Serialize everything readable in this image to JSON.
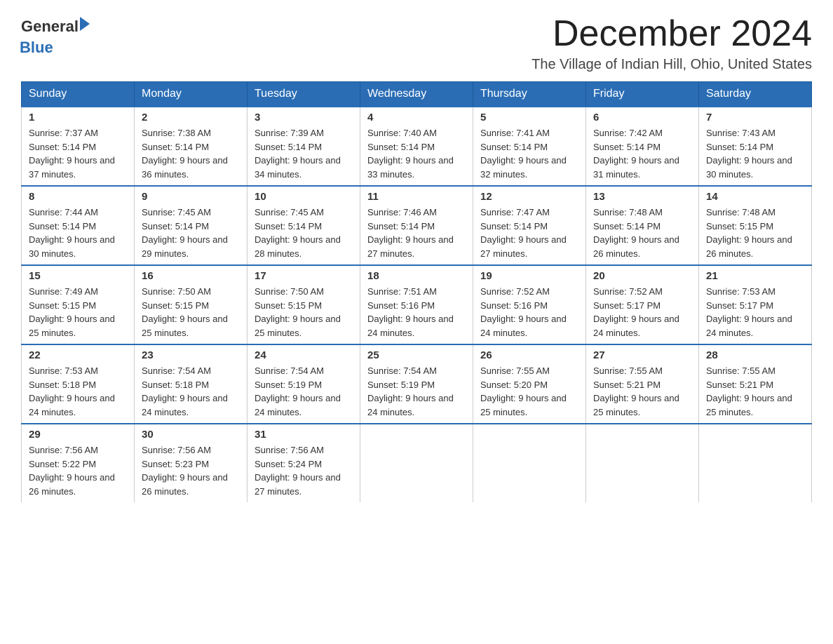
{
  "header": {
    "logo_general": "General",
    "logo_blue": "Blue",
    "month_title": "December 2024",
    "location": "The Village of Indian Hill, Ohio, United States"
  },
  "days_of_week": [
    "Sunday",
    "Monday",
    "Tuesday",
    "Wednesday",
    "Thursday",
    "Friday",
    "Saturday"
  ],
  "weeks": [
    [
      {
        "day": "1",
        "sunrise": "7:37 AM",
        "sunset": "5:14 PM",
        "daylight": "9 hours and 37 minutes."
      },
      {
        "day": "2",
        "sunrise": "7:38 AM",
        "sunset": "5:14 PM",
        "daylight": "9 hours and 36 minutes."
      },
      {
        "day": "3",
        "sunrise": "7:39 AM",
        "sunset": "5:14 PM",
        "daylight": "9 hours and 34 minutes."
      },
      {
        "day": "4",
        "sunrise": "7:40 AM",
        "sunset": "5:14 PM",
        "daylight": "9 hours and 33 minutes."
      },
      {
        "day": "5",
        "sunrise": "7:41 AM",
        "sunset": "5:14 PM",
        "daylight": "9 hours and 32 minutes."
      },
      {
        "day": "6",
        "sunrise": "7:42 AM",
        "sunset": "5:14 PM",
        "daylight": "9 hours and 31 minutes."
      },
      {
        "day": "7",
        "sunrise": "7:43 AM",
        "sunset": "5:14 PM",
        "daylight": "9 hours and 30 minutes."
      }
    ],
    [
      {
        "day": "8",
        "sunrise": "7:44 AM",
        "sunset": "5:14 PM",
        "daylight": "9 hours and 30 minutes."
      },
      {
        "day": "9",
        "sunrise": "7:45 AM",
        "sunset": "5:14 PM",
        "daylight": "9 hours and 29 minutes."
      },
      {
        "day": "10",
        "sunrise": "7:45 AM",
        "sunset": "5:14 PM",
        "daylight": "9 hours and 28 minutes."
      },
      {
        "day": "11",
        "sunrise": "7:46 AM",
        "sunset": "5:14 PM",
        "daylight": "9 hours and 27 minutes."
      },
      {
        "day": "12",
        "sunrise": "7:47 AM",
        "sunset": "5:14 PM",
        "daylight": "9 hours and 27 minutes."
      },
      {
        "day": "13",
        "sunrise": "7:48 AM",
        "sunset": "5:14 PM",
        "daylight": "9 hours and 26 minutes."
      },
      {
        "day": "14",
        "sunrise": "7:48 AM",
        "sunset": "5:15 PM",
        "daylight": "9 hours and 26 minutes."
      }
    ],
    [
      {
        "day": "15",
        "sunrise": "7:49 AM",
        "sunset": "5:15 PM",
        "daylight": "9 hours and 25 minutes."
      },
      {
        "day": "16",
        "sunrise": "7:50 AM",
        "sunset": "5:15 PM",
        "daylight": "9 hours and 25 minutes."
      },
      {
        "day": "17",
        "sunrise": "7:50 AM",
        "sunset": "5:15 PM",
        "daylight": "9 hours and 25 minutes."
      },
      {
        "day": "18",
        "sunrise": "7:51 AM",
        "sunset": "5:16 PM",
        "daylight": "9 hours and 24 minutes."
      },
      {
        "day": "19",
        "sunrise": "7:52 AM",
        "sunset": "5:16 PM",
        "daylight": "9 hours and 24 minutes."
      },
      {
        "day": "20",
        "sunrise": "7:52 AM",
        "sunset": "5:17 PM",
        "daylight": "9 hours and 24 minutes."
      },
      {
        "day": "21",
        "sunrise": "7:53 AM",
        "sunset": "5:17 PM",
        "daylight": "9 hours and 24 minutes."
      }
    ],
    [
      {
        "day": "22",
        "sunrise": "7:53 AM",
        "sunset": "5:18 PM",
        "daylight": "9 hours and 24 minutes."
      },
      {
        "day": "23",
        "sunrise": "7:54 AM",
        "sunset": "5:18 PM",
        "daylight": "9 hours and 24 minutes."
      },
      {
        "day": "24",
        "sunrise": "7:54 AM",
        "sunset": "5:19 PM",
        "daylight": "9 hours and 24 minutes."
      },
      {
        "day": "25",
        "sunrise": "7:54 AM",
        "sunset": "5:19 PM",
        "daylight": "9 hours and 24 minutes."
      },
      {
        "day": "26",
        "sunrise": "7:55 AM",
        "sunset": "5:20 PM",
        "daylight": "9 hours and 25 minutes."
      },
      {
        "day": "27",
        "sunrise": "7:55 AM",
        "sunset": "5:21 PM",
        "daylight": "9 hours and 25 minutes."
      },
      {
        "day": "28",
        "sunrise": "7:55 AM",
        "sunset": "5:21 PM",
        "daylight": "9 hours and 25 minutes."
      }
    ],
    [
      {
        "day": "29",
        "sunrise": "7:56 AM",
        "sunset": "5:22 PM",
        "daylight": "9 hours and 26 minutes."
      },
      {
        "day": "30",
        "sunrise": "7:56 AM",
        "sunset": "5:23 PM",
        "daylight": "9 hours and 26 minutes."
      },
      {
        "day": "31",
        "sunrise": "7:56 AM",
        "sunset": "5:24 PM",
        "daylight": "9 hours and 27 minutes."
      },
      {
        "day": "",
        "sunrise": "",
        "sunset": "",
        "daylight": ""
      },
      {
        "day": "",
        "sunrise": "",
        "sunset": "",
        "daylight": ""
      },
      {
        "day": "",
        "sunrise": "",
        "sunset": "",
        "daylight": ""
      },
      {
        "day": "",
        "sunrise": "",
        "sunset": "",
        "daylight": ""
      }
    ]
  ]
}
